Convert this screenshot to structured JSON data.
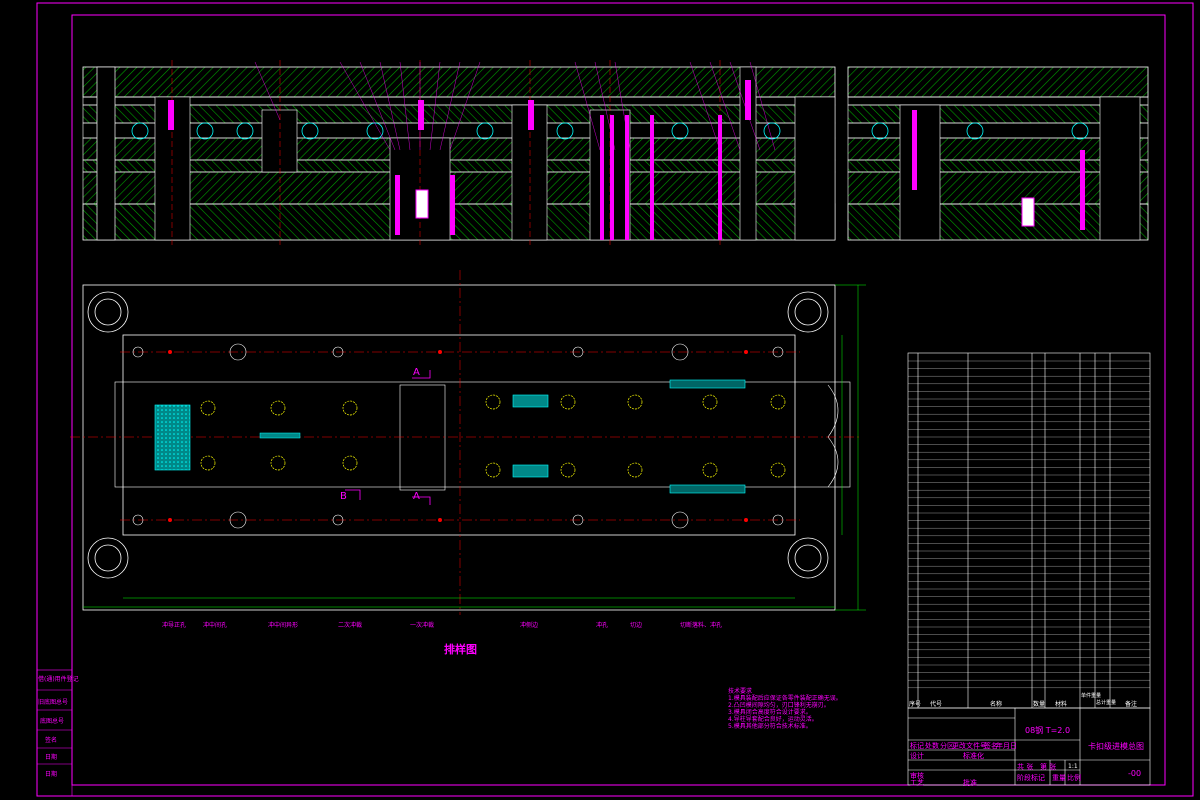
{
  "drawing": {
    "layout_label": "排样图",
    "section_label_a": "A",
    "section_label_b": "B",
    "strip_steps": [
      "冲导正孔",
      "冲中间孔",
      "冲中间异形",
      "二次冲裁",
      "一次冲裁",
      "冲侧边",
      "冲孔",
      "切边",
      "切断落料、冲孔"
    ],
    "tech_req_title": "技术要求",
    "tech_req_items": [
      "1.模具装配后应保证各零件装配正确无误。",
      "2.凸凹模间隙均匀，刃口锋利无崩刃。",
      "3.模具闭合高度符合设计要求。",
      "4.导柱导套配合良好，运动灵活。",
      "5.模具其他部分符合技术标准。"
    ],
    "title_block": {
      "part_name": "卡扣级进模总图",
      "material_line": "08钢 T=2.0",
      "drawing_no": "-00",
      "scale": "1:1",
      "labels": [
        "标记",
        "处数",
        "分区",
        "更改文件号",
        "签名",
        "年月日",
        "设计",
        "标准化",
        "阶段标记",
        "重量",
        "比例",
        "审核",
        "工艺",
        "批准",
        "共 张",
        "第 张"
      ]
    },
    "left_stamp": [
      "借(通)用件登记",
      "旧底图总号",
      "底图总号",
      "签名",
      "日期"
    ],
    "bom_header": [
      "序号",
      "代号",
      "名称",
      "数量",
      "材料",
      "单件重量",
      "总计重量",
      "备注"
    ]
  },
  "colors": {
    "background": "#000000",
    "frame": "#ff00ff",
    "outline": "#ffffff",
    "hatch": "#00ff00",
    "center": "#ff0000",
    "cyan": "#00ffff",
    "yellow": "#ffff00"
  }
}
